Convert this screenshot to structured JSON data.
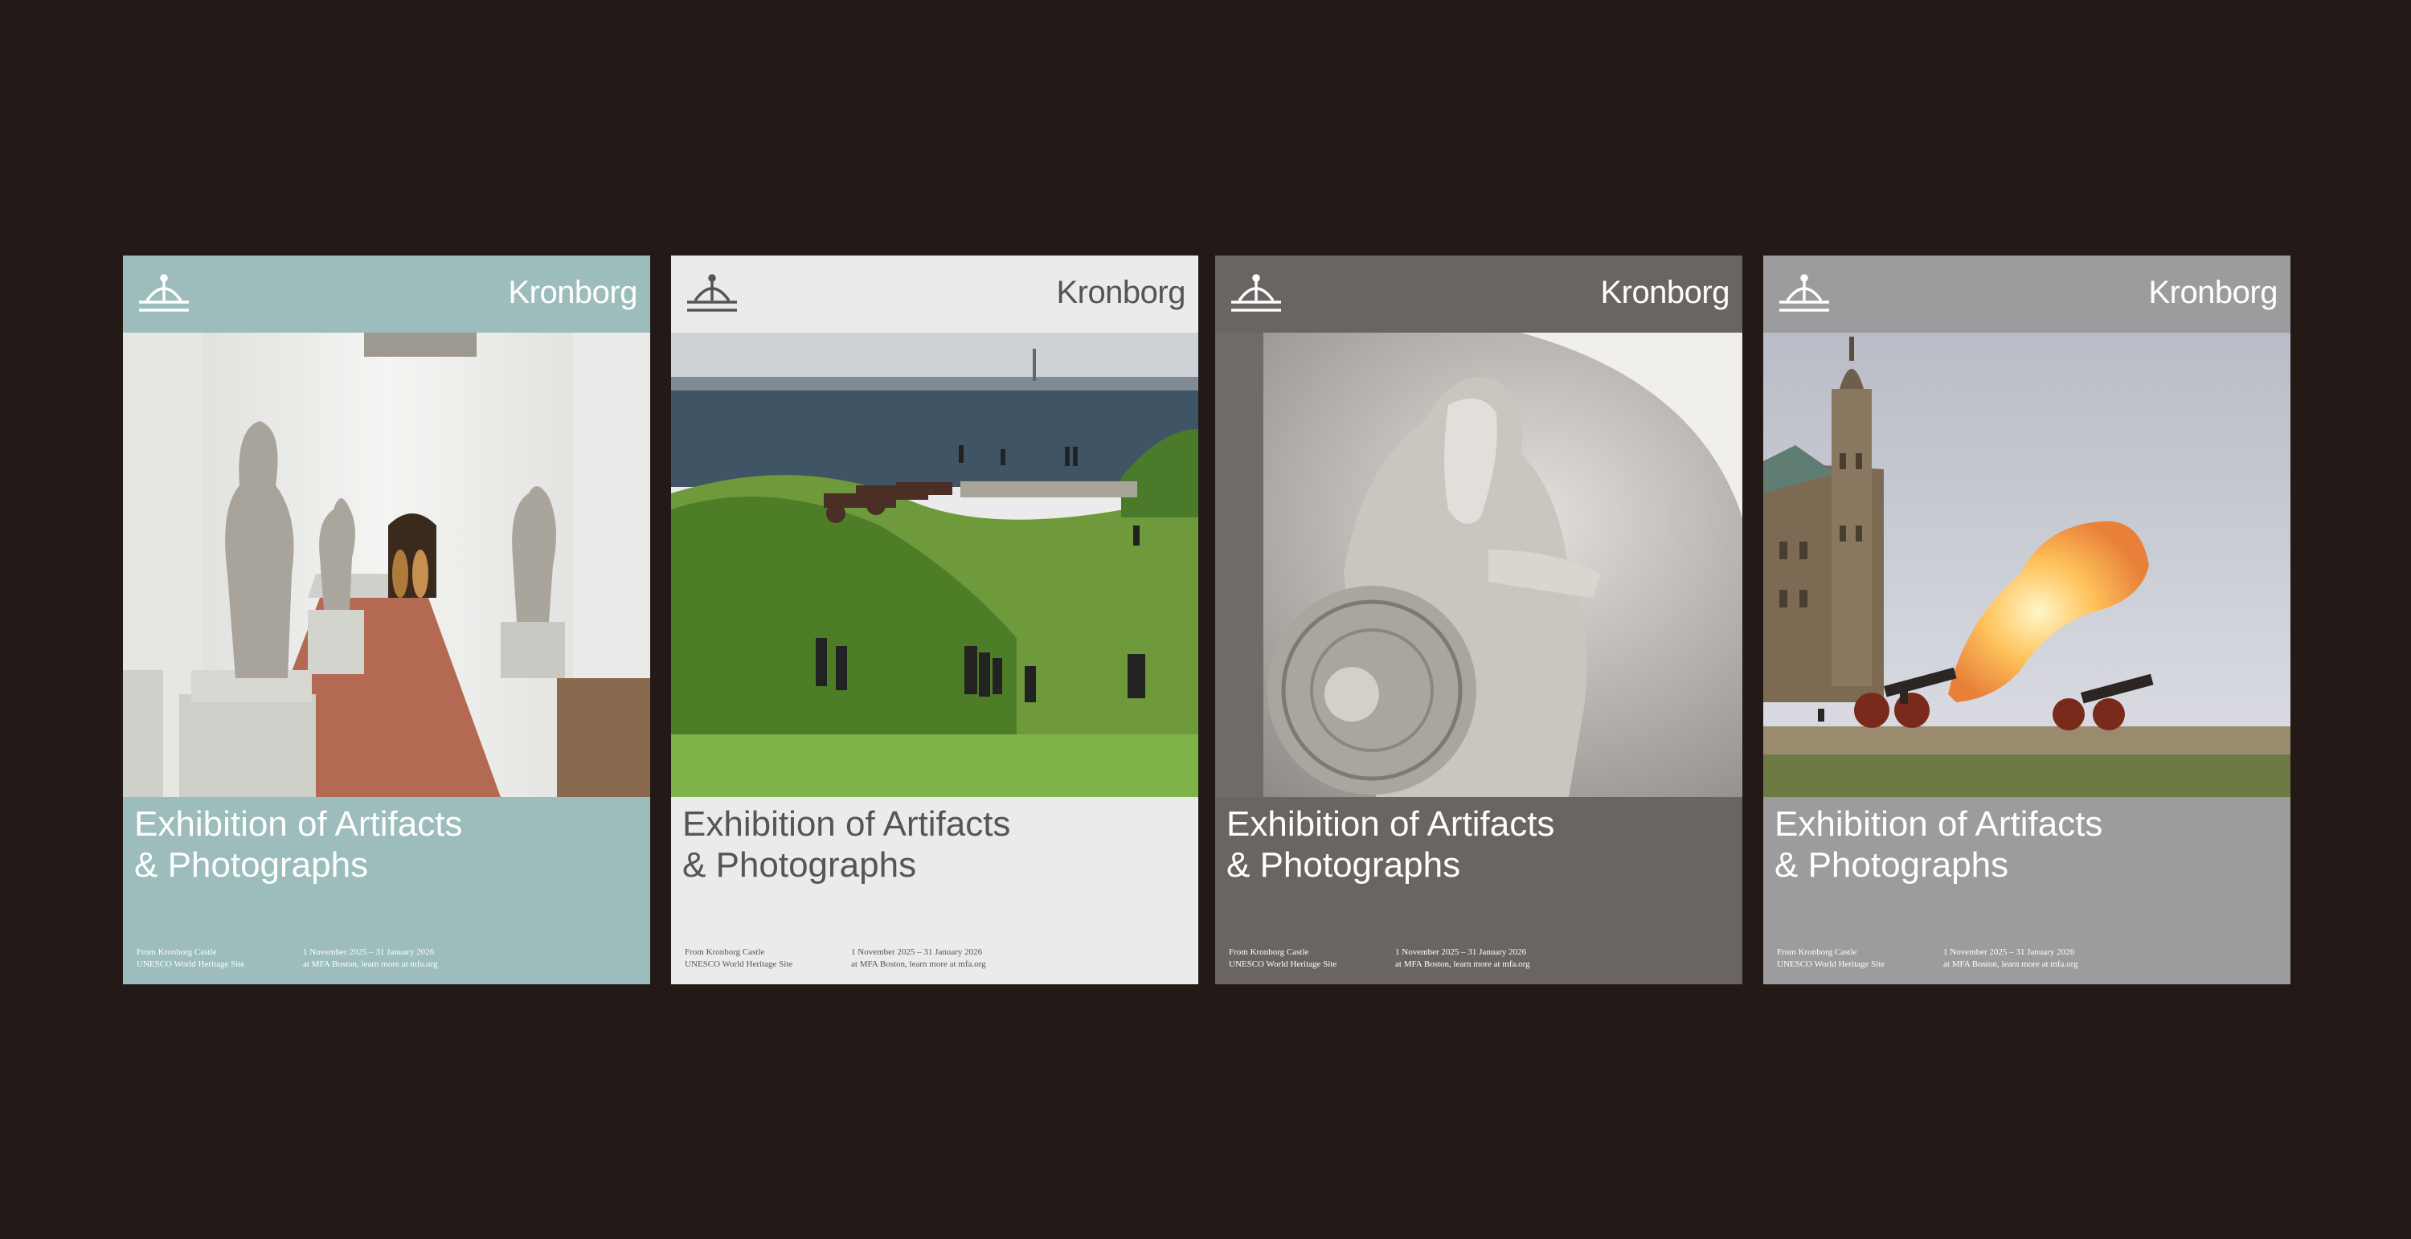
{
  "colors": {
    "background": "#231a17",
    "teal": "#9cbdbb",
    "light": "#ebebeb",
    "taupe": "#6a6562",
    "gray": "#9c9c9f"
  },
  "posters": [
    {
      "logo_icon": "crown-icon",
      "brand": "Kronborg",
      "photo": "statue-gallery-corridor",
      "title_line1": "Exhibition of Artifacts",
      "title_line2": "& Photographs",
      "from_line1": "From Kronborg Castle",
      "from_line2": "UNESCO World Heritage Site",
      "dates_line1": "1 November 2025 – 31 January 2026",
      "dates_line2": "at MFA Boston, learn more at mfa.org"
    },
    {
      "logo_icon": "crown-icon",
      "brand": "Kronborg",
      "photo": "ramparts-cannons-visitors-sea",
      "title_line1": "Exhibition of Artifacts",
      "title_line2": "& Photographs",
      "from_line1": "From Kronborg Castle",
      "from_line2": "UNESCO World Heritage Site",
      "dates_line1": "1 November 2025 – 31 January 2026",
      "dates_line2": "at MFA Boston, learn more at mfa.org"
    },
    {
      "logo_icon": "crown-icon",
      "brand": "Kronborg",
      "photo": "holger-danske-statue-with-shield",
      "title_line1": "Exhibition of Artifacts",
      "title_line2": "& Photographs",
      "from_line1": "From Kronborg Castle",
      "from_line2": "UNESCO World Heritage Site",
      "dates_line1": "1 November 2025 – 31 January 2026",
      "dates_line2": "at MFA Boston, learn more at mfa.org"
    },
    {
      "logo_icon": "crown-icon",
      "brand": "Kronborg",
      "photo": "castle-tower-cannon-firing",
      "title_line1": "Exhibition of Artifacts",
      "title_line2": "& Photographs",
      "from_line1": "From Kronborg Castle",
      "from_line2": "UNESCO World Heritage Site",
      "dates_line1": "1 November 2025 – 31 January 2026",
      "dates_line2": "at MFA Boston, learn more at mfa.org"
    }
  ]
}
